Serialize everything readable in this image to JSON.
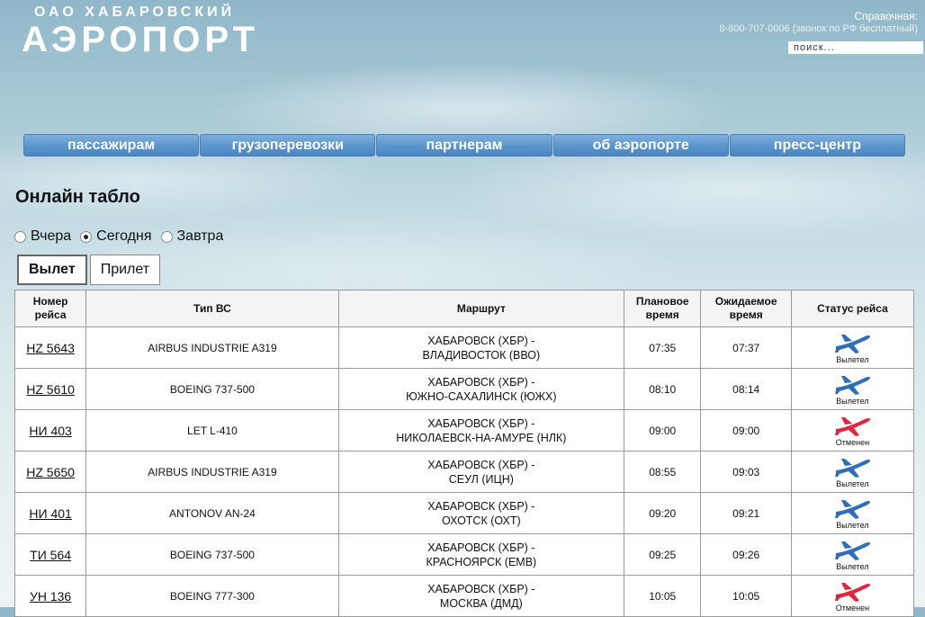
{
  "header": {
    "brand_sub": "ОАО ХАБАРОВСКИЙ",
    "brand_main": "АЭРОПОРТ",
    "help_label": "Справочная:",
    "help_phone": "8-800-707-0006 (звонок по РФ бесплатный)",
    "search_placeholder": "поиск..."
  },
  "nav": [
    "пассажирам",
    "грузоперевозки",
    "партнерам",
    "об аэропорте",
    "пресс-центр"
  ],
  "page_title": "Онлайн табло",
  "days": [
    {
      "label": "Вчера",
      "checked": false
    },
    {
      "label": "Сегодня",
      "checked": true
    },
    {
      "label": "Завтра",
      "checked": false
    }
  ],
  "tabs": [
    {
      "label": "Вылет",
      "active": true
    },
    {
      "label": "Прилет",
      "active": false
    }
  ],
  "table": {
    "headers": [
      "Номер\nрейса",
      "Тип ВС",
      "Маршрут",
      "Плановое\nвремя",
      "Ожидаемое\nвремя",
      "Статус рейса"
    ],
    "rows": [
      {
        "flight": "HZ 5643",
        "aircraft": "AIRBUS INDUSTRIE A319",
        "route_from": "ХАБАРОВСК (ХБР) -",
        "route_to": "ВЛАДИВОСТОК (ВВО)",
        "planned": "07:35",
        "expected": "07:37",
        "status": "Вылетел",
        "status_icon": "plane-blue-icon"
      },
      {
        "flight": "HZ 5610",
        "aircraft": "BOEING 737-500",
        "route_from": "ХАБАРОВСК (ХБР) -",
        "route_to": "ЮЖНО-САХАЛИНСК (ЮЖХ)",
        "planned": "08:10",
        "expected": "08:14",
        "status": "Вылетел",
        "status_icon": "plane-blue-icon"
      },
      {
        "flight": "НИ 403",
        "aircraft": "LET L-410",
        "route_from": "ХАБАРОВСК (ХБР) -",
        "route_to": "НИКОЛАЕВСК-НА-АМУРЕ (НЛК)",
        "planned": "09:00",
        "expected": "09:00",
        "status": "Отменен",
        "status_icon": "plane-red-icon"
      },
      {
        "flight": "HZ 5650",
        "aircraft": "AIRBUS INDUSTRIE A319",
        "route_from": "ХАБАРОВСК (ХБР) -",
        "route_to": "СЕУЛ (ИЦН)",
        "planned": "08:55",
        "expected": "09:03",
        "status": "Вылетел",
        "status_icon": "plane-blue-icon"
      },
      {
        "flight": "НИ 401",
        "aircraft": "ANTONOV AN-24",
        "route_from": "ХАБАРОВСК (ХБР) -",
        "route_to": "ОХОТСК (ОХТ)",
        "planned": "09:20",
        "expected": "09:21",
        "status": "Вылетел",
        "status_icon": "plane-blue-icon"
      },
      {
        "flight": "ТИ 564",
        "aircraft": "BOEING 737-500",
        "route_from": "ХАБАРОВСК (ХБР) -",
        "route_to": "КРАСНОЯРСК (ЕМВ)",
        "planned": "09:25",
        "expected": "09:26",
        "status": "Вылетел",
        "status_icon": "plane-blue-icon"
      },
      {
        "flight": "УН 136",
        "aircraft": "BOEING 777-300",
        "route_from": "ХАБАРОВСК (ХБР) -",
        "route_to": "МОСКВА (ДМД)",
        "planned": "10:05",
        "expected": "10:05",
        "status": "Отменен",
        "status_icon": "plane-red-icon"
      }
    ]
  },
  "colors": {
    "nav_blue": "#5b94cc",
    "plane_departed": "#2f6fb8",
    "plane_cancelled": "#e0283c"
  }
}
